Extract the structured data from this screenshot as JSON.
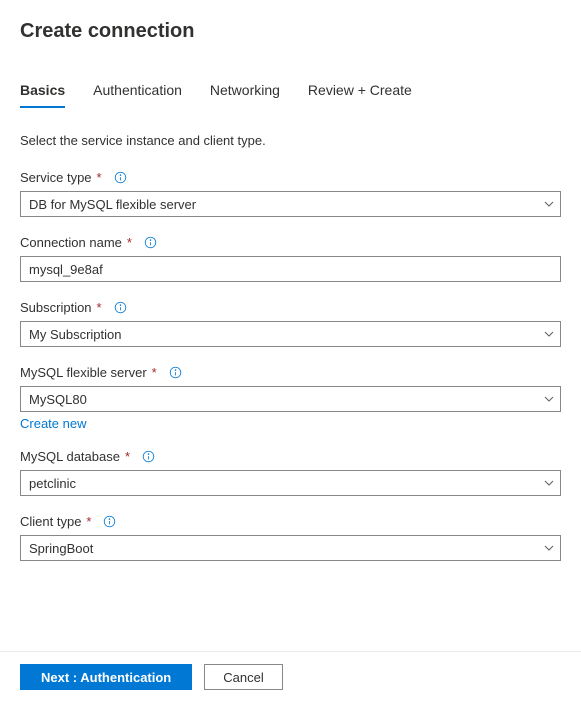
{
  "header": {
    "title": "Create connection"
  },
  "tabs": {
    "items": [
      {
        "label": "Basics",
        "active": true
      },
      {
        "label": "Authentication",
        "active": false
      },
      {
        "label": "Networking",
        "active": false
      },
      {
        "label": "Review + Create",
        "active": false
      }
    ]
  },
  "intro": "Select the service instance and client type.",
  "fields": {
    "serviceType": {
      "label": "Service type",
      "value": "DB for MySQL flexible server"
    },
    "connectionName": {
      "label": "Connection name",
      "value": "mysql_9e8af"
    },
    "subscription": {
      "label": "Subscription",
      "value": "My Subscription"
    },
    "mysqlServer": {
      "label": "MySQL flexible server",
      "value": "MySQL80",
      "createNew": "Create new"
    },
    "mysqlDatabase": {
      "label": "MySQL database",
      "value": "petclinic"
    },
    "clientType": {
      "label": "Client type",
      "value": "SpringBoot"
    }
  },
  "footer": {
    "next": "Next : Authentication",
    "cancel": "Cancel"
  }
}
